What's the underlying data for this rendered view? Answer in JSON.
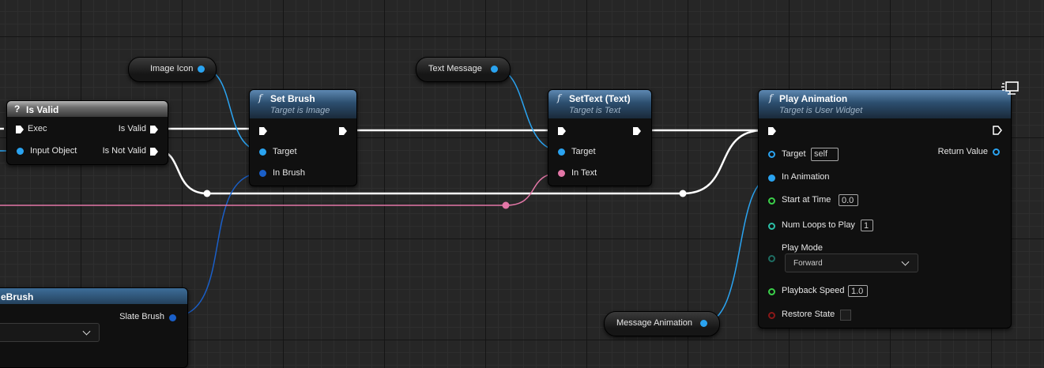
{
  "nodes": {
    "is_valid": {
      "title": "Is Valid",
      "icon": "question-icon",
      "pins": {
        "exec": "Exec",
        "input_object": "Input Object",
        "is_valid": "Is Valid",
        "is_not_valid": "Is Not Valid"
      }
    },
    "set_brush": {
      "title": "Set Brush",
      "subtitle": "Target is Image",
      "icon": "function-icon",
      "pins": {
        "target": "Target",
        "in_brush": "In Brush"
      }
    },
    "set_text": {
      "title": "SetText (Text)",
      "subtitle": "Target is Text",
      "icon": "function-icon",
      "pins": {
        "target": "Target",
        "in_text": "In Text"
      }
    },
    "play_animation": {
      "title": "Play Animation",
      "subtitle": "Target is User Widget",
      "icon": "function-icon",
      "corner_icon": "widget-monitor-icon",
      "pins": {
        "target": "Target",
        "target_value": "self",
        "return_value": "Return Value",
        "in_animation": "In Animation",
        "start_at_time": "Start at Time",
        "start_at_time_value": "0.0",
        "num_loops": "Num Loops to Play",
        "num_loops_value": "1",
        "play_mode": "Play Mode",
        "play_mode_value": "Forward",
        "playback_speed": "Playback Speed",
        "playback_speed_value": "1.0",
        "restore_state": "Restore State"
      }
    },
    "make_slate_brush": {
      "title_visible": "eBrush",
      "pins": {
        "slate_brush": "Slate Brush"
      }
    }
  },
  "variables": {
    "image_icon": "Image Icon",
    "text_message": "Text Message",
    "message_animation": "Message Animation"
  },
  "colors": {
    "exec_wire": "#ffffff",
    "object_pin": "#2aa3f0",
    "struct_pin": "#1a5fc8",
    "text_pin": "#e377a7",
    "float_pin": "#3bd14a",
    "int_pin": "#2cc0a8",
    "bool_pin": "#8a1818",
    "function_header": "#3d6d98",
    "pure_header": "#7a7a7a"
  }
}
